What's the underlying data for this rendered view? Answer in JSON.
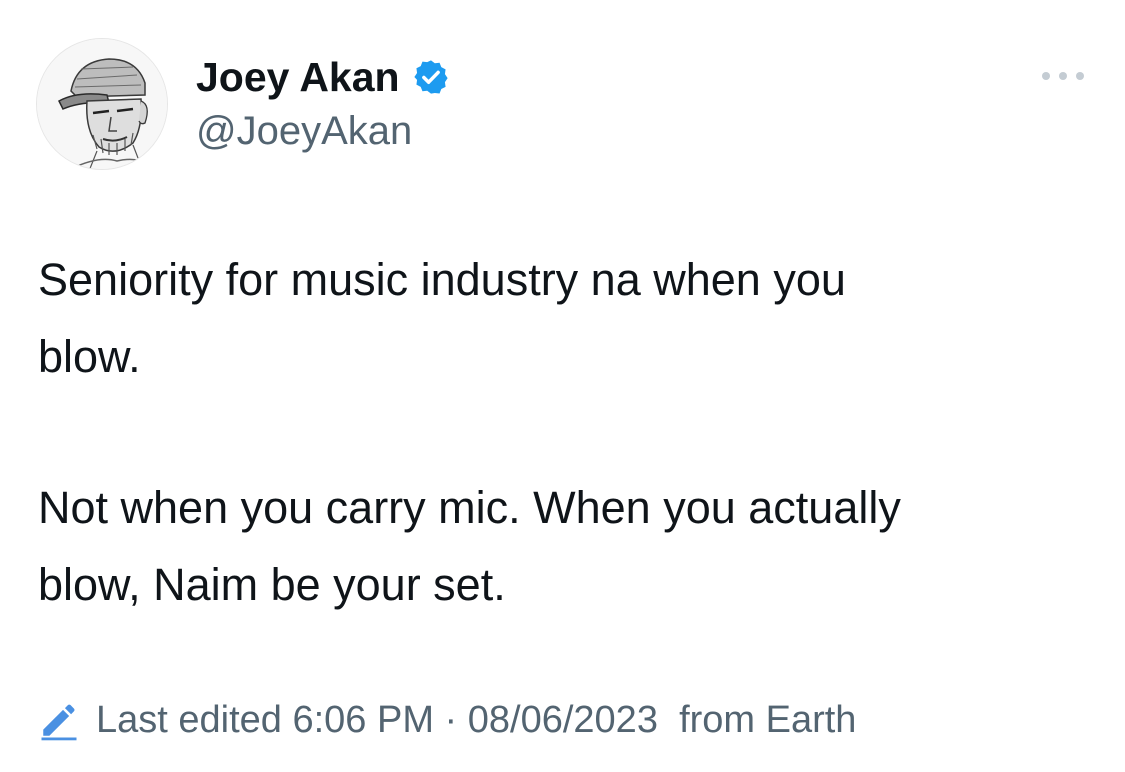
{
  "author": {
    "display_name": "Joey Akan",
    "handle": "@JoeyAkan",
    "verified": true
  },
  "tweet": {
    "paragraphs": [
      {
        "line1": "Seniority for music industry na when you",
        "line2": "blow."
      },
      {
        "line1": "Not when you carry mic. When you actually",
        "line2": "blow, Naim be your set."
      }
    ]
  },
  "footer": {
    "edited_label": "Last edited 6:06 PM · 08/06/2023  from Earth"
  },
  "icons": {
    "verified": "verified-badge-icon",
    "more": "more-options-icon",
    "edit": "pencil-edit-icon"
  },
  "colors": {
    "verified_blue": "#1d9bf0",
    "edit_blue": "#4a90e2",
    "secondary_text": "#536471",
    "primary_text": "#0f1419"
  }
}
